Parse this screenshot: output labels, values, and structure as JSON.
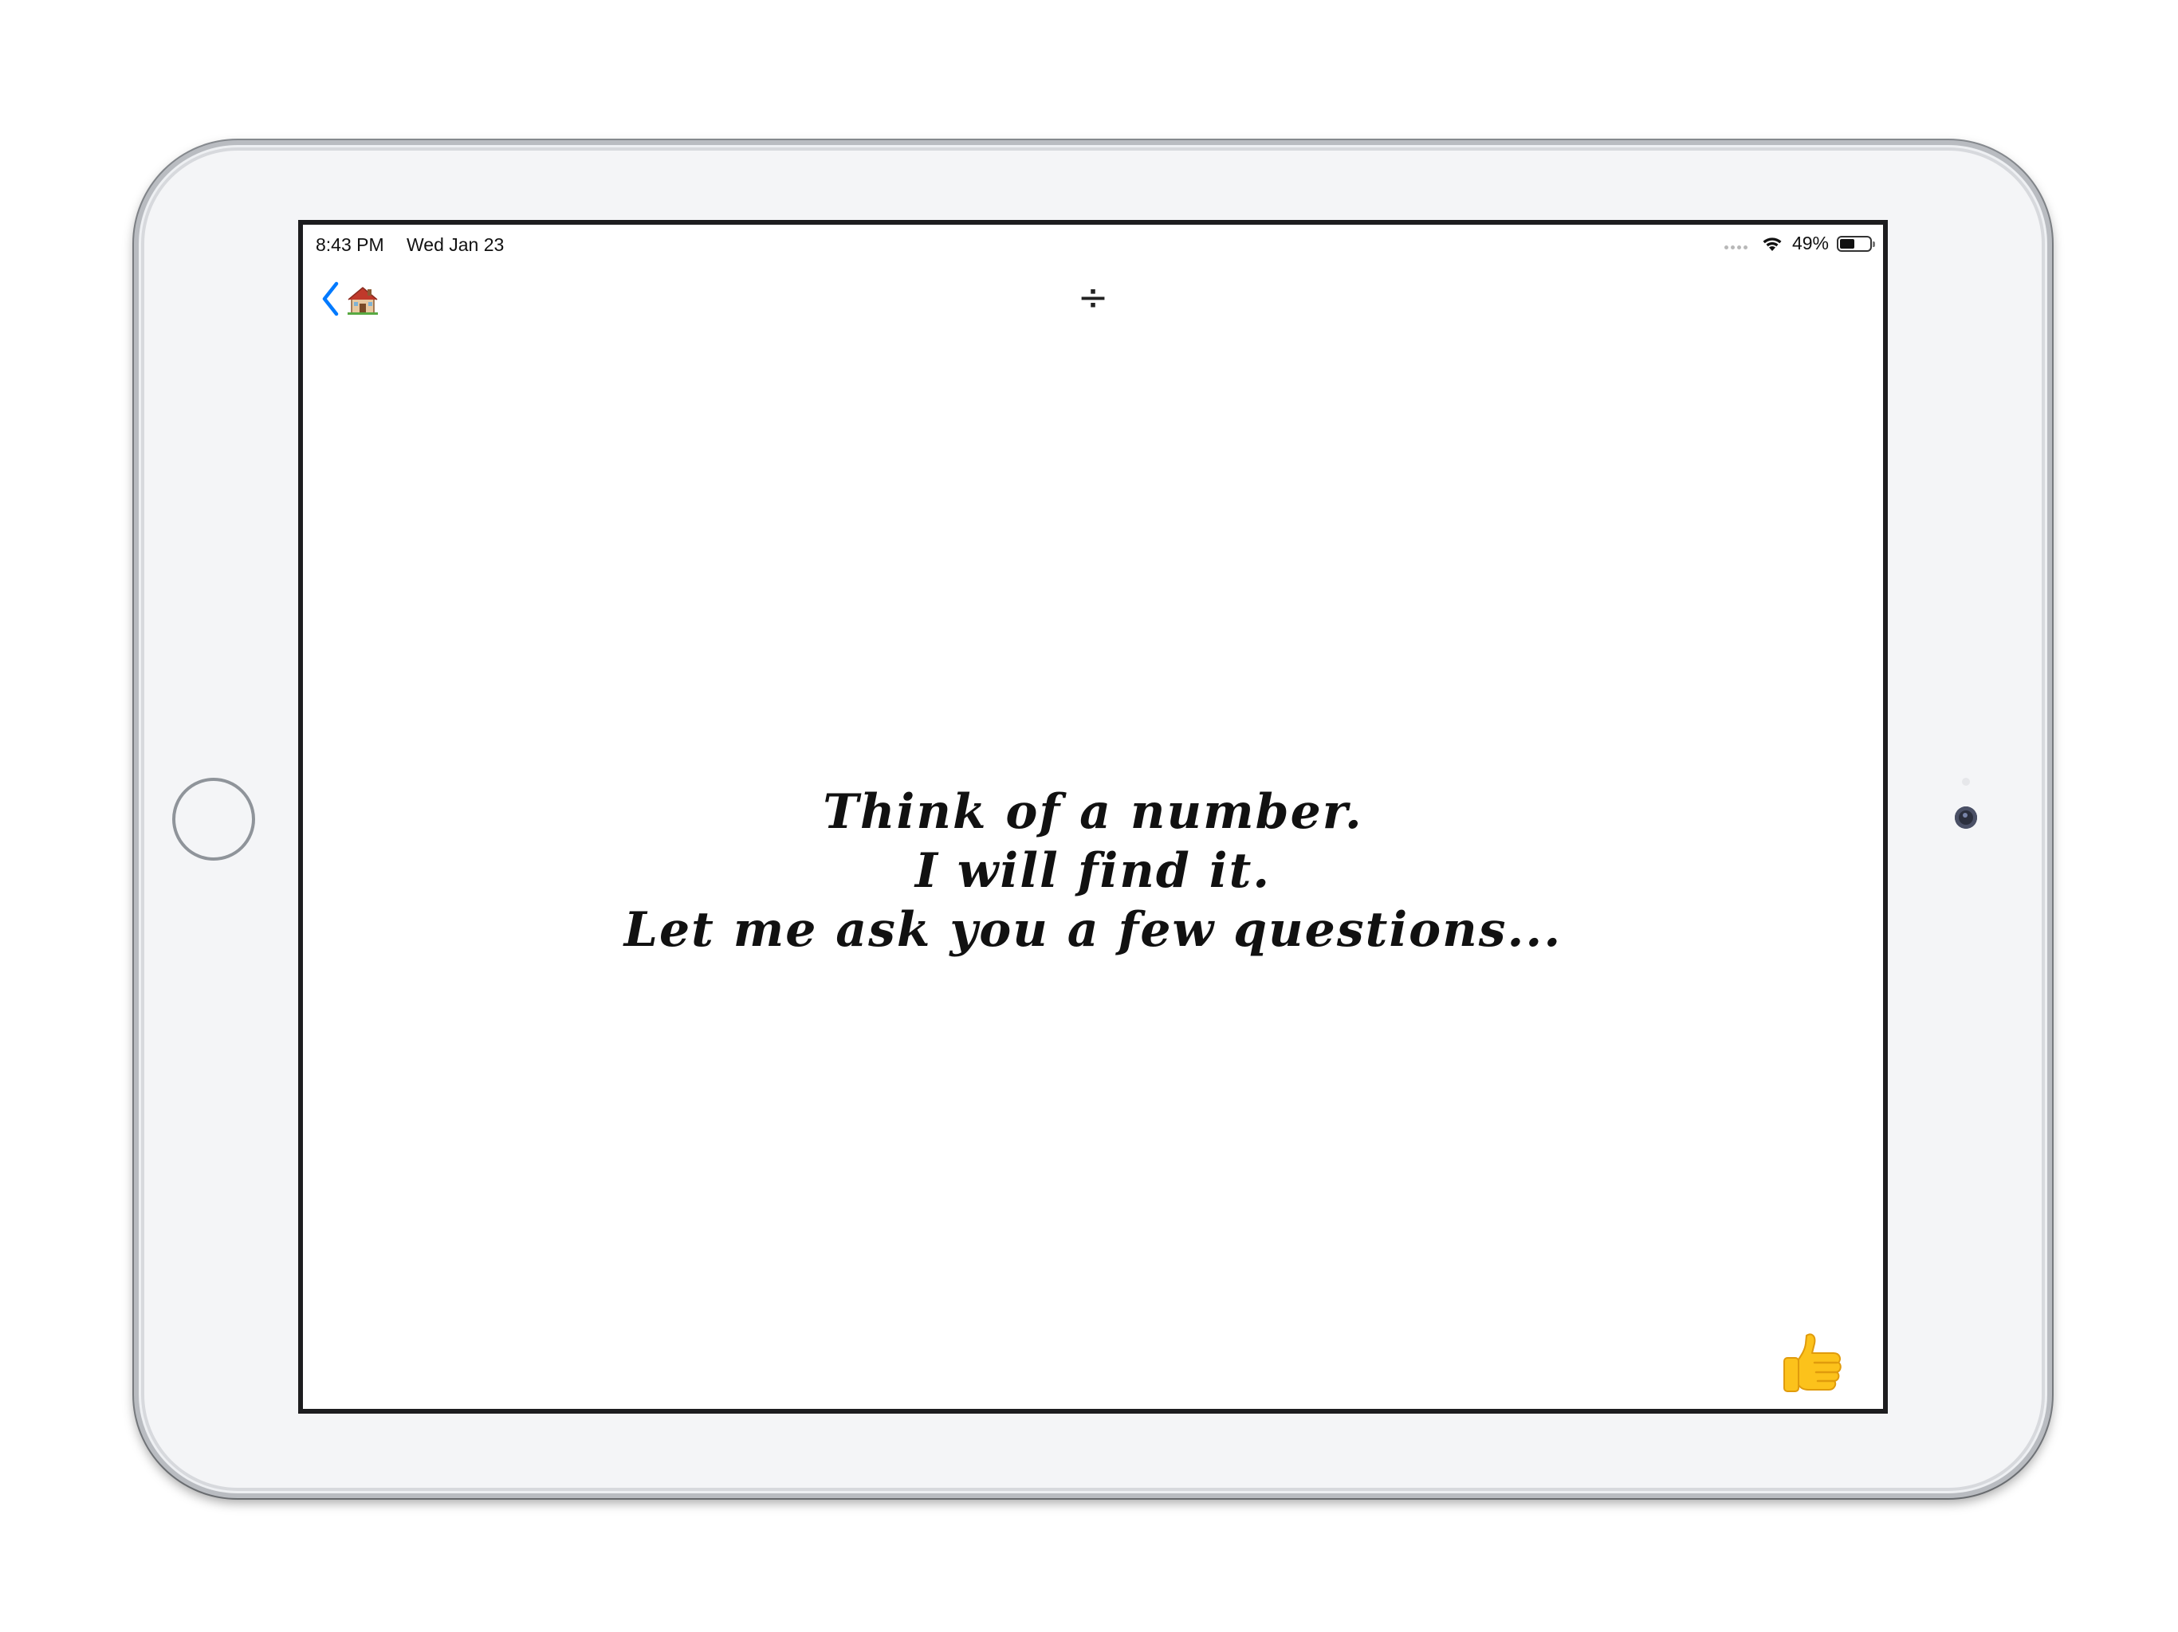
{
  "status_bar": {
    "time": "8:43 PM",
    "date": "Wed Jan 23",
    "battery_percent": "49%",
    "battery_level": 0.49
  },
  "nav": {
    "back_icon": "chevron-left-icon",
    "home_icon": "house-icon",
    "title": "÷"
  },
  "message": {
    "line1": "Think of a number.",
    "line2": "I will find it.",
    "line3": "Let me ask you a few questions..."
  },
  "actions": {
    "confirm_icon": "thumbs-up-icon"
  },
  "colors": {
    "accent": "#007aff",
    "text": "#111111",
    "screen_bg": "#ffffff",
    "device_bezel": "#f4f5f7"
  }
}
